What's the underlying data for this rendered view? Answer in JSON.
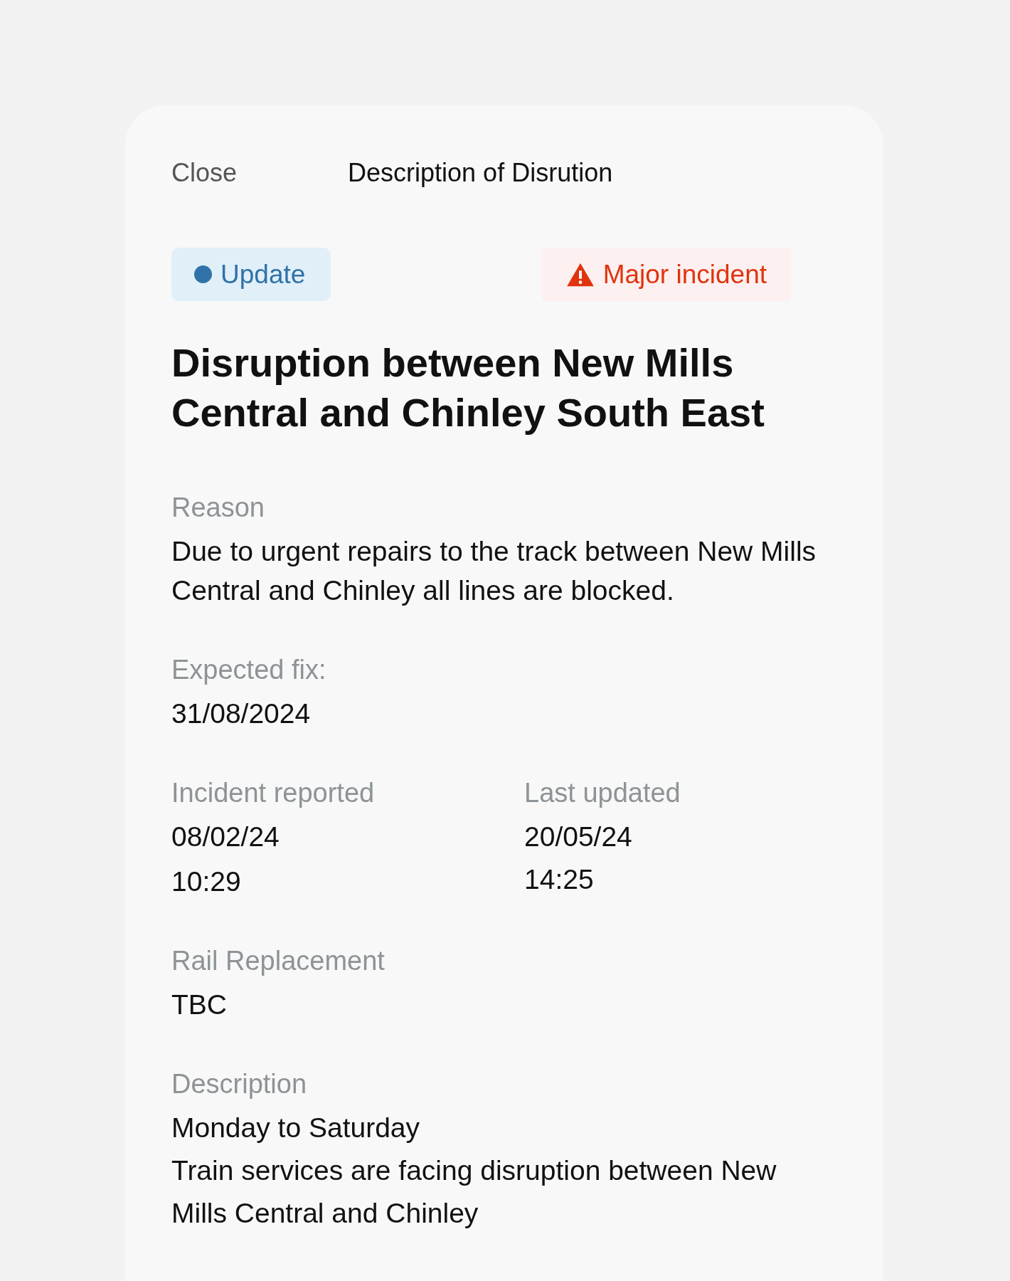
{
  "header": {
    "close": "Close",
    "title": "Description of Disrution"
  },
  "badges": [
    {
      "kind": "status",
      "label": "Update",
      "color": "#2f72a8"
    },
    {
      "kind": "severity",
      "label": "Major incident",
      "color": "#e0340e"
    }
  ],
  "heading": "Disruption between New Mills Central and  Chinley South East",
  "sections": [
    {
      "kind": "single",
      "label": "Reason",
      "lines": [
        "Due to urgent repairs to the track between New Mills Central and Chinley all lines are blocked."
      ]
    },
    {
      "kind": "single",
      "label": "Expected fix:",
      "lines": [
        "31/08/2024"
      ]
    },
    {
      "kind": "pair",
      "columns": [
        {
          "label": "Incident reported",
          "lines": [
            "08/02/24",
            "10:29"
          ]
        },
        {
          "label": "Last updated",
          "lines": [
            "20/05/24",
            "14:25"
          ]
        }
      ]
    },
    {
      "kind": "single",
      "label": "Rail Replacement",
      "lines": [
        "TBC"
      ]
    },
    {
      "kind": "single",
      "label": "Description",
      "lines": [
        "Monday to Saturday",
        "Train services are facing disruption between New Mills Central and Chinley"
      ]
    }
  ]
}
